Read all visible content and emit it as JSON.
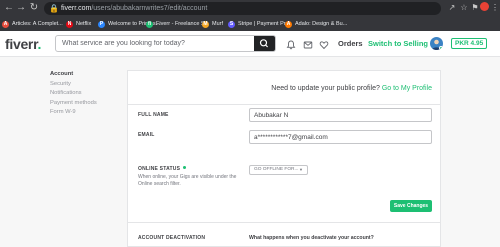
{
  "browser": {
    "url_host": "fiverr.com",
    "url_path": "/users/abubakarnwrites7/edit/account",
    "bookmarks": [
      {
        "label": "Articles: A Complet...",
        "color": "#e74c3c",
        "glyph": "A"
      },
      {
        "label": "Netflix",
        "color": "#e50914",
        "glyph": "N"
      },
      {
        "label": "Welcome to Primes...",
        "color": "#2b87ff",
        "glyph": "P"
      },
      {
        "label": "Fiverr - Freelance S...",
        "color": "#1dbf73",
        "glyph": "fi"
      },
      {
        "label": "Murf",
        "color": "#f5a623",
        "glyph": "M"
      },
      {
        "label": "Stripe | Payment Pr...",
        "color": "#635bff",
        "glyph": "S"
      },
      {
        "label": "Adalo: Design & Bu...",
        "color": "#ff7a00",
        "glyph": "A"
      }
    ]
  },
  "header": {
    "logo": "fiverr",
    "logo_dot": ".",
    "search_placeholder": "What service are you looking for today?",
    "orders": "Orders",
    "switch_to_selling": "Switch to Selling",
    "balance": "PKR 4.95"
  },
  "sidebar": {
    "items": [
      "Account",
      "Security",
      "Notifications",
      "Payment methods",
      "Form W-9"
    ],
    "active": "Account"
  },
  "account": {
    "profile_prompt": "Need to update your public profile?",
    "profile_link": "Go to My Profile",
    "full_name_label": "FULL NAME",
    "full_name_value": "Abubakar N",
    "email_label": "EMAIL",
    "email_value": "a************7@gmail.com",
    "online_status_label": "ONLINE STATUS",
    "online_status_hint": "When online, your Gigs are visible under the Online search filter.",
    "online_status_value": "GO OFFLINE FOR...",
    "save_button": "Save Changes",
    "deactivation_label": "ACCOUNT DEACTIVATION",
    "deactivation_question": "What happens when you deactivate your account?"
  },
  "colors": {
    "brand_green": "#1dbf73",
    "chrome_dark": "#35363a",
    "text_dark": "#404145"
  }
}
